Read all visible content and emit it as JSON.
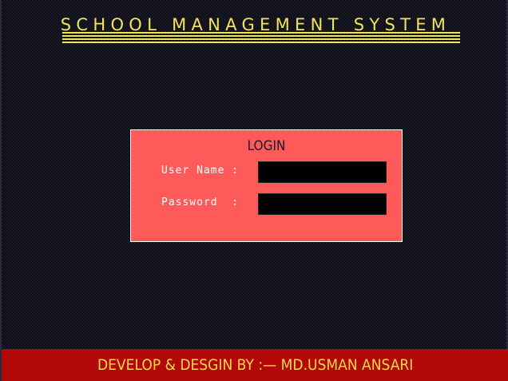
{
  "app": {
    "title": "SCHOOL MANAGEMENT SYSTEM",
    "underline": "================================================"
  },
  "login": {
    "heading": "LOGIN",
    "username_label": "User Name :",
    "username_value": "",
    "password_label": "Password  :",
    "password_value": ""
  },
  "footer": {
    "credit": "DEVELOP & DESGIN BY :— MD.USMAN ANSARI"
  },
  "colors": {
    "title": "#f2e45a",
    "login_panel": "#ff5a5a",
    "input_bg": "#000000",
    "footer_bg": "#b20808",
    "footer_text": "#ffd84a"
  }
}
